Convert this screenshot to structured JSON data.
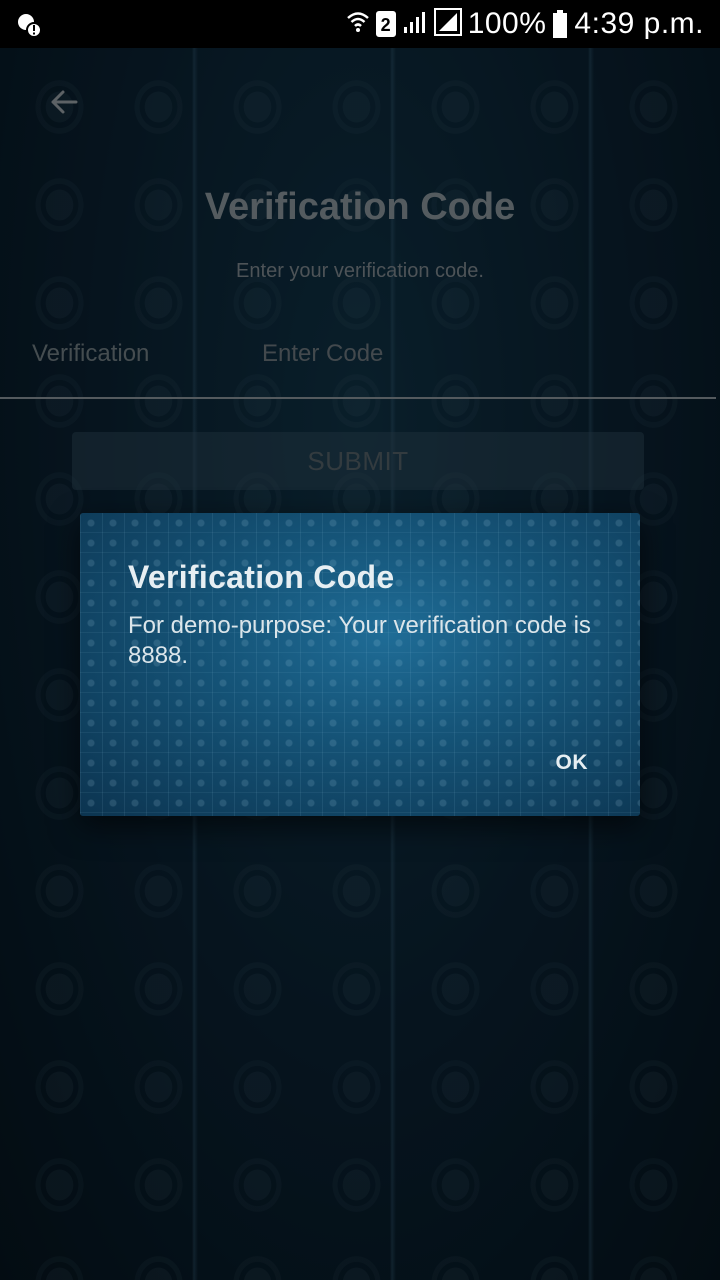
{
  "status_bar": {
    "battery_percent": "100%",
    "time": "4:39 p.m.",
    "sim_slot": "2"
  },
  "screen": {
    "title": "Verification Code",
    "subtitle": "Enter your verification code.",
    "field_label": "Verification",
    "input_placeholder": "Enter Code",
    "input_value": "",
    "submit_label": "SUBMIT"
  },
  "dialog": {
    "title": "Verification Code",
    "message": "For demo-purpose: Your verification code is 8888.",
    "ok_label": "OK"
  },
  "colors": {
    "background": "#0b2436",
    "dialog_accent": "#1f6c96",
    "text_light": "#e6eef2"
  }
}
